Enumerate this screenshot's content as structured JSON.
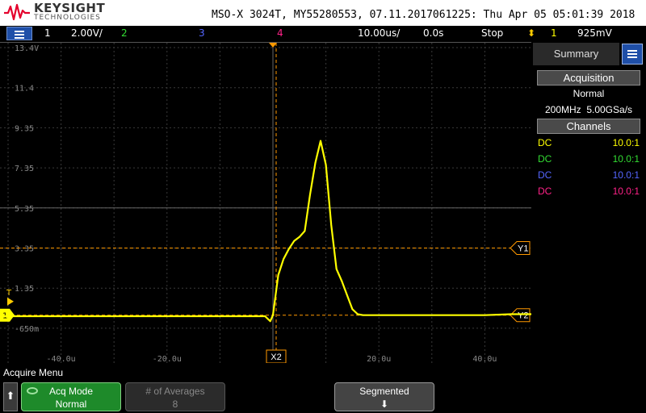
{
  "header": {
    "brand": "KEYSIGHT",
    "brand_sub": "TECHNOLOGIES",
    "info": "MSO-X 3024T, MY55280553, 07.11.2017061225: Thu Apr 05 05:01:39 2018"
  },
  "status": {
    "ch1_num": "1",
    "ch1_scale": "2.00V/",
    "ch2_num": "2",
    "ch3_num": "3",
    "ch4_num": "4",
    "timebase": "10.00us/",
    "delay": "0.0s",
    "run_state": "Stop",
    "trig_source": "1",
    "trig_level": "925mV"
  },
  "colors": {
    "ch1": "#ffff00",
    "ch2": "#33dd33",
    "ch3": "#5566ff",
    "ch4": "#ff2288",
    "trigger": "#ff9900",
    "softkey_green": "#1e8a2a",
    "menu_blue": "#1f4fa8"
  },
  "plot": {
    "y_labels": [
      "13.4V",
      "11.4",
      "9.35",
      "7.35",
      "5.35",
      "3.35",
      "1.35",
      "-650m"
    ],
    "x_labels": [
      "-40.0u",
      "-20.0u",
      "20.0u",
      "40.0u"
    ],
    "markers": {
      "y1": "Y1",
      "y2": "Y2",
      "x": "X2",
      "trigger": "T",
      "ch1_ground": "1"
    },
    "waveform_us": [
      -55,
      -40,
      -20,
      -10,
      -1.5,
      -0.5,
      0,
      0.5,
      1,
      2,
      3,
      4,
      5,
      6,
      7,
      8,
      9,
      10,
      11,
      12,
      13,
      14,
      15,
      16,
      17,
      18,
      19,
      20,
      30,
      40,
      45,
      53
    ],
    "waveform_v": [
      -0.05,
      -0.05,
      -0.05,
      -0.05,
      -0.05,
      -0.3,
      0.0,
      1.0,
      2.0,
      2.8,
      3.3,
      3.7,
      3.9,
      4.2,
      6.0,
      7.6,
      8.7,
      7.5,
      4.5,
      2.3,
      1.7,
      1.0,
      0.3,
      0.05,
      0.0,
      0.0,
      0.0,
      0.0,
      0.0,
      0.0,
      0.05,
      0.05
    ]
  },
  "sidebar": {
    "tab_summary": "Summary",
    "acquisition_title": "Acquisition",
    "acq_mode": "Normal",
    "acq_bw": "200MHz",
    "acq_rate": "5.00GSa/s",
    "channels_title": "Channels",
    "channels": [
      {
        "coupling": "DC",
        "probe": "10.0:1",
        "color": "#ffff00"
      },
      {
        "coupling": "DC",
        "probe": "10.0:1",
        "color": "#33dd33"
      },
      {
        "coupling": "DC",
        "probe": "10.0:1",
        "color": "#5566ff"
      },
      {
        "coupling": "DC",
        "probe": "10.0:1",
        "color": "#ff2288"
      }
    ]
  },
  "menu": {
    "title": "Acquire Menu",
    "back_glyph": "⬆",
    "acq_mode_label": "Acq Mode",
    "acq_mode_value": "Normal",
    "averages_label": "# of Averages",
    "averages_value": "8",
    "segmented_label": "Segmented"
  }
}
